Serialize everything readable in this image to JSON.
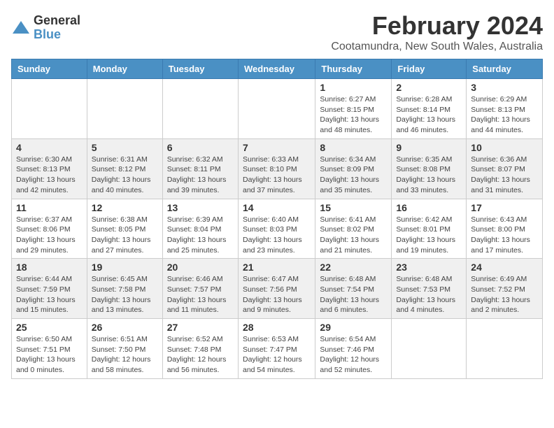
{
  "logo": {
    "general": "General",
    "blue": "Blue"
  },
  "title": "February 2024",
  "subtitle": "Cootamundra, New South Wales, Australia",
  "days_of_week": [
    "Sunday",
    "Monday",
    "Tuesday",
    "Wednesday",
    "Thursday",
    "Friday",
    "Saturday"
  ],
  "weeks": [
    [
      {
        "day": "",
        "info": ""
      },
      {
        "day": "",
        "info": ""
      },
      {
        "day": "",
        "info": ""
      },
      {
        "day": "",
        "info": ""
      },
      {
        "day": "1",
        "info": "Sunrise: 6:27 AM\nSunset: 8:15 PM\nDaylight: 13 hours\nand 48 minutes."
      },
      {
        "day": "2",
        "info": "Sunrise: 6:28 AM\nSunset: 8:14 PM\nDaylight: 13 hours\nand 46 minutes."
      },
      {
        "day": "3",
        "info": "Sunrise: 6:29 AM\nSunset: 8:13 PM\nDaylight: 13 hours\nand 44 minutes."
      }
    ],
    [
      {
        "day": "4",
        "info": "Sunrise: 6:30 AM\nSunset: 8:13 PM\nDaylight: 13 hours\nand 42 minutes."
      },
      {
        "day": "5",
        "info": "Sunrise: 6:31 AM\nSunset: 8:12 PM\nDaylight: 13 hours\nand 40 minutes."
      },
      {
        "day": "6",
        "info": "Sunrise: 6:32 AM\nSunset: 8:11 PM\nDaylight: 13 hours\nand 39 minutes."
      },
      {
        "day": "7",
        "info": "Sunrise: 6:33 AM\nSunset: 8:10 PM\nDaylight: 13 hours\nand 37 minutes."
      },
      {
        "day": "8",
        "info": "Sunrise: 6:34 AM\nSunset: 8:09 PM\nDaylight: 13 hours\nand 35 minutes."
      },
      {
        "day": "9",
        "info": "Sunrise: 6:35 AM\nSunset: 8:08 PM\nDaylight: 13 hours\nand 33 minutes."
      },
      {
        "day": "10",
        "info": "Sunrise: 6:36 AM\nSunset: 8:07 PM\nDaylight: 13 hours\nand 31 minutes."
      }
    ],
    [
      {
        "day": "11",
        "info": "Sunrise: 6:37 AM\nSunset: 8:06 PM\nDaylight: 13 hours\nand 29 minutes."
      },
      {
        "day": "12",
        "info": "Sunrise: 6:38 AM\nSunset: 8:05 PM\nDaylight: 13 hours\nand 27 minutes."
      },
      {
        "day": "13",
        "info": "Sunrise: 6:39 AM\nSunset: 8:04 PM\nDaylight: 13 hours\nand 25 minutes."
      },
      {
        "day": "14",
        "info": "Sunrise: 6:40 AM\nSunset: 8:03 PM\nDaylight: 13 hours\nand 23 minutes."
      },
      {
        "day": "15",
        "info": "Sunrise: 6:41 AM\nSunset: 8:02 PM\nDaylight: 13 hours\nand 21 minutes."
      },
      {
        "day": "16",
        "info": "Sunrise: 6:42 AM\nSunset: 8:01 PM\nDaylight: 13 hours\nand 19 minutes."
      },
      {
        "day": "17",
        "info": "Sunrise: 6:43 AM\nSunset: 8:00 PM\nDaylight: 13 hours\nand 17 minutes."
      }
    ],
    [
      {
        "day": "18",
        "info": "Sunrise: 6:44 AM\nSunset: 7:59 PM\nDaylight: 13 hours\nand 15 minutes."
      },
      {
        "day": "19",
        "info": "Sunrise: 6:45 AM\nSunset: 7:58 PM\nDaylight: 13 hours\nand 13 minutes."
      },
      {
        "day": "20",
        "info": "Sunrise: 6:46 AM\nSunset: 7:57 PM\nDaylight: 13 hours\nand 11 minutes."
      },
      {
        "day": "21",
        "info": "Sunrise: 6:47 AM\nSunset: 7:56 PM\nDaylight: 13 hours\nand 9 minutes."
      },
      {
        "day": "22",
        "info": "Sunrise: 6:48 AM\nSunset: 7:54 PM\nDaylight: 13 hours\nand 6 minutes."
      },
      {
        "day": "23",
        "info": "Sunrise: 6:48 AM\nSunset: 7:53 PM\nDaylight: 13 hours\nand 4 minutes."
      },
      {
        "day": "24",
        "info": "Sunrise: 6:49 AM\nSunset: 7:52 PM\nDaylight: 13 hours\nand 2 minutes."
      }
    ],
    [
      {
        "day": "25",
        "info": "Sunrise: 6:50 AM\nSunset: 7:51 PM\nDaylight: 13 hours\nand 0 minutes."
      },
      {
        "day": "26",
        "info": "Sunrise: 6:51 AM\nSunset: 7:50 PM\nDaylight: 12 hours\nand 58 minutes."
      },
      {
        "day": "27",
        "info": "Sunrise: 6:52 AM\nSunset: 7:48 PM\nDaylight: 12 hours\nand 56 minutes."
      },
      {
        "day": "28",
        "info": "Sunrise: 6:53 AM\nSunset: 7:47 PM\nDaylight: 12 hours\nand 54 minutes."
      },
      {
        "day": "29",
        "info": "Sunrise: 6:54 AM\nSunset: 7:46 PM\nDaylight: 12 hours\nand 52 minutes."
      },
      {
        "day": "",
        "info": ""
      },
      {
        "day": "",
        "info": ""
      }
    ]
  ]
}
